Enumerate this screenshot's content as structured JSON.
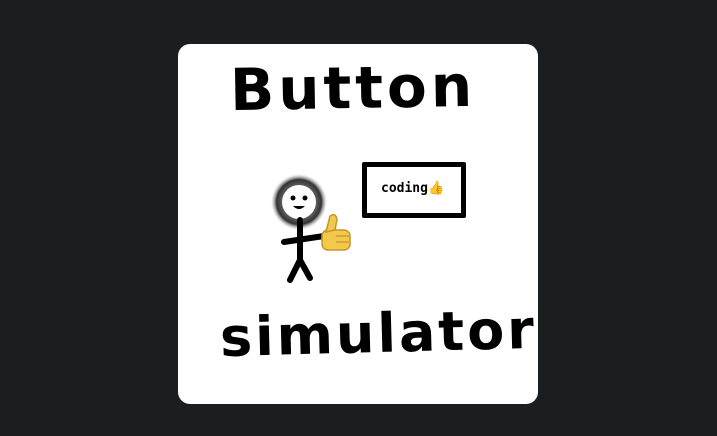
{
  "card": {
    "title_line1": "Button",
    "title_line2": "simulator",
    "sign_text": "coding👍"
  },
  "icons": {
    "stick_figure": "stick-figure-icon",
    "thumbs_up": "thumbs-up-icon"
  },
  "colors": {
    "background": "#1c1d21",
    "card": "#ffffff",
    "ink": "#000000",
    "thumb": "#f2c94c"
  }
}
